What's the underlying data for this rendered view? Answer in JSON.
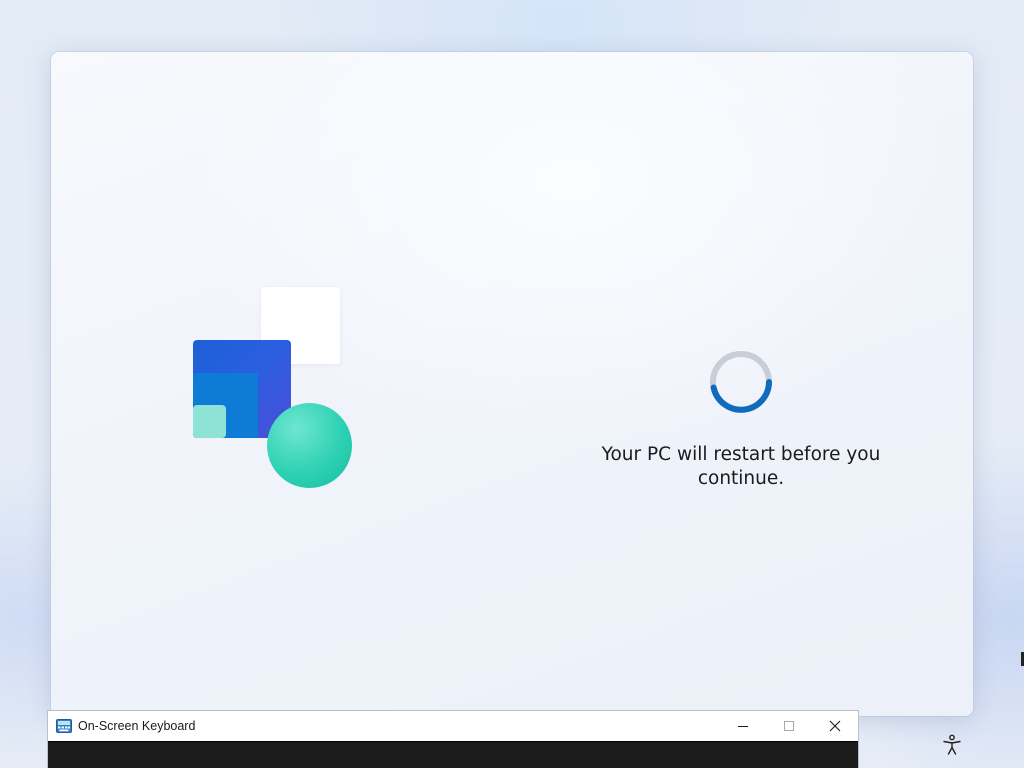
{
  "status": {
    "message": "Your PC will restart before you continue."
  },
  "osk_window": {
    "title": "On-Screen Keyboard",
    "minimize_icon": "minimize-icon",
    "maximize_icon": "maximize-icon",
    "close_icon": "close-icon"
  },
  "icons": {
    "spinner": "loading-spinner-icon",
    "accessibility": "accessibility-icon",
    "osk_app": "keyboard-app-icon"
  },
  "colors": {
    "accent": "#0f6cbd",
    "spinner_track": "#c9ced6",
    "illustration_blue": "#2a5fe0",
    "illustration_teal": "#2fd1b4"
  }
}
